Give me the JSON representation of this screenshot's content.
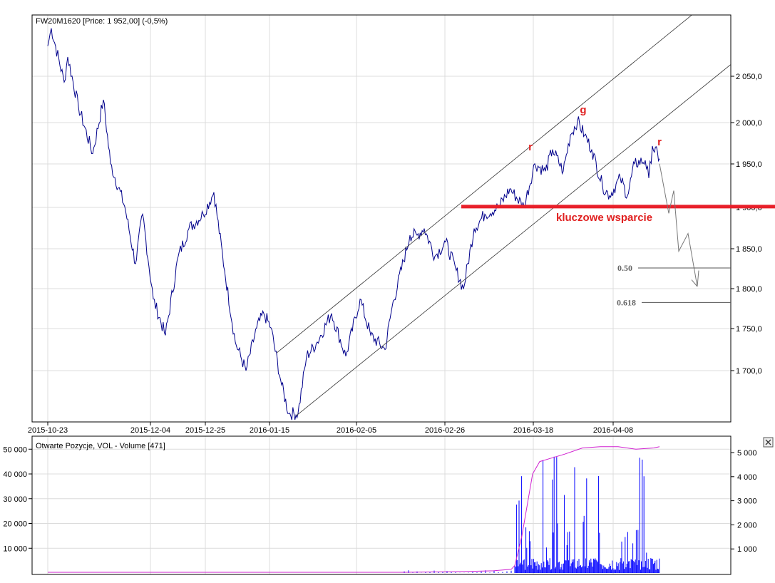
{
  "chart_data": [
    {
      "type": "line",
      "title": "FW20M1620 [Price: 1 952,00] (-0,5%)",
      "x_tick_labels": [
        "2015-10-23",
        "2015-12-04",
        "2015-12-25",
        "2016-01-15",
        "2016-02-05",
        "2016-02-26",
        "2016-03-18",
        "2016-04-08"
      ],
      "x_tick_day_index": [
        0,
        28.8,
        44.2,
        62.2,
        86.6,
        111.4,
        136.2,
        158.6
      ],
      "y_tick_labels": [
        "2 050,0",
        "2 000,0",
        "1 950,0",
        "1 900,0",
        "1 850,0",
        "1 800,0",
        "1 750,0",
        "1 700,0"
      ],
      "y_ticks": [
        2050,
        2000,
        1950,
        1900,
        1850,
        1800,
        1750,
        1700
      ],
      "ylim": [
        1620,
        2125
      ],
      "xlim": [
        -4.4,
        191.6
      ],
      "grid": true,
      "series": [
        {
          "name": "FW20M1620",
          "color": "#00008b",
          "points": [
            [
              0,
              2086
            ],
            [
              1,
              2107
            ],
            [
              4.6,
              2043
            ],
            [
              5.6,
              2073
            ],
            [
              8.6,
              2014
            ],
            [
              12.6,
              1958
            ],
            [
              15.6,
              2022
            ],
            [
              17.6,
              1946
            ],
            [
              21.6,
              1895
            ],
            [
              24.6,
              1827
            ],
            [
              26.6,
              1886
            ],
            [
              29.6,
              1785
            ],
            [
              33,
              1742
            ],
            [
              36.6,
              1836
            ],
            [
              39.6,
              1869
            ],
            [
              43.6,
              1886
            ],
            [
              46.6,
              1912
            ],
            [
              49.6,
              1819
            ],
            [
              52.6,
              1734
            ],
            [
              55.6,
              1700
            ],
            [
              58.6,
              1751
            ],
            [
              60.6,
              1768
            ],
            [
              62.6,
              1751
            ],
            [
              65.6,
              1683
            ],
            [
              67.6,
              1649
            ],
            [
              70.2,
              1649
            ],
            [
              72.6,
              1717
            ],
            [
              75.6,
              1734
            ],
            [
              79.6,
              1768
            ],
            [
              83.6,
              1717
            ],
            [
              87.6,
              1785
            ],
            [
              90.6,
              1742
            ],
            [
              94.6,
              1725
            ],
            [
              96.6,
              1776
            ],
            [
              101.6,
              1861
            ],
            [
              103.6,
              1861
            ],
            [
              105.6,
              1869
            ],
            [
              108.6,
              1836
            ],
            [
              111.6,
              1853
            ],
            [
              114.6,
              1819
            ],
            [
              116.6,
              1797
            ],
            [
              119.6,
              1869
            ],
            [
              122.6,
              1886
            ],
            [
              126.6,
              1895
            ],
            [
              129.6,
              1916
            ],
            [
              133.6,
              1895
            ],
            [
              136.6,
              1946
            ],
            [
              139.6,
              1937
            ],
            [
              141.6,
              1963
            ],
            [
              144.6,
              1937
            ],
            [
              146.6,
              1980
            ],
            [
              148.6,
              1997
            ],
            [
              150.6,
              1980
            ],
            [
              152.6,
              1963
            ],
            [
              155.6,
              1920
            ],
            [
              157.6,
              1908
            ],
            [
              160.6,
              1929
            ],
            [
              162.6,
              1908
            ],
            [
              164.6,
              1946
            ],
            [
              167.6,
              1950
            ],
            [
              168.6,
              1929
            ],
            [
              169.6,
              1967
            ],
            [
              171.6,
              1952
            ]
          ]
        }
      ],
      "channel_lines": [
        {
          "name": "upper-channel",
          "from": [
            64.2,
            1721
          ],
          "to": [
            181,
            2124
          ]
        },
        {
          "name": "lower-channel",
          "from": [
            69.6,
            1646
          ],
          "to": [
            191.6,
            2064
          ]
        }
      ],
      "support_line": {
        "price": 1895,
        "from_day": 116,
        "label": "kluczowe wsparcie",
        "color": "#e8202a"
      },
      "forecast_path": [
        [
          171.6,
          1946
        ],
        [
          174.2,
          1887
        ],
        [
          175.6,
          1914
        ],
        [
          177,
          1842
        ],
        [
          179.6,
          1863
        ],
        [
          182.2,
          1800
        ],
        [
          182.6,
          1819
        ]
      ],
      "fib_levels": [
        {
          "label": "0.50",
          "price": 1822
        },
        {
          "label": "0.618",
          "price": 1781
        }
      ],
      "wave_labels": [
        {
          "label": "r",
          "day": 135.4,
          "price": 1962
        },
        {
          "label": "g",
          "day": 150.2,
          "price": 2006
        },
        {
          "label": "r",
          "day": 171.6,
          "price": 1968
        }
      ]
    },
    {
      "type": "bar",
      "title": "Otwarte Pozycje, VOL - Volume [471]",
      "left_y_tick_labels": [
        "50 000",
        "40 000",
        "30 000",
        "20 000",
        "10 000"
      ],
      "left_y_ticks": [
        50000,
        40000,
        30000,
        20000,
        10000
      ],
      "right_y_tick_labels": [
        "5 000",
        "4 000",
        "3 000",
        "2 000",
        "1 000"
      ],
      "right_y_ticks": [
        5000,
        4000,
        3000,
        2000,
        1000
      ],
      "left_ylim": [
        0,
        52000
      ],
      "right_ylim": [
        0,
        5200
      ],
      "series": [
        {
          "name": "Otwarte Pozycje",
          "axis": "left",
          "color": "#d020d0",
          "points": [
            [
              0,
              300
            ],
            [
              100,
              300
            ],
            [
              117,
              600
            ],
            [
              125,
              900
            ],
            [
              130,
              1500
            ],
            [
              131,
              3000
            ],
            [
              133,
              15000
            ],
            [
              136,
              40000
            ],
            [
              138,
              45000
            ],
            [
              145,
              48000
            ],
            [
              150,
              50500
            ],
            [
              155,
              51000
            ],
            [
              160,
              51000
            ],
            [
              165,
              50000
            ],
            [
              170,
              50500
            ],
            [
              171.6,
              51000
            ]
          ]
        },
        {
          "name": "Volume",
          "axis": "right",
          "color": "#0000ff",
          "start_day": 131,
          "end_day": 171.6,
          "typical": 400,
          "peak": 5000
        }
      ]
    }
  ],
  "ui": {
    "close_icon": "close-icon"
  }
}
